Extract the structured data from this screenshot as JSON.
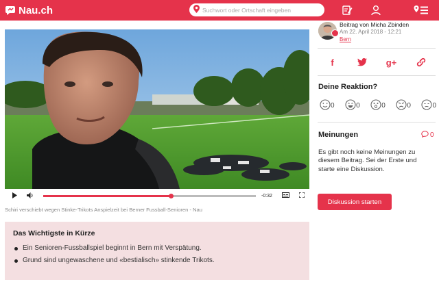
{
  "header": {
    "logo_text": "Nau.ch",
    "search_placeholder": "Suchwort oder Ortschaft eingeben",
    "icons": [
      "pin-icon",
      "edit-icon",
      "user-icon",
      "menu-icon"
    ],
    "brand_color": "#e5334b"
  },
  "video": {
    "time_remaining": "-0:32",
    "progress_fraction": 0.6,
    "caption": "Schiri verschiebt wegen Stinke-Trikots Anspielzeit bei Berner Fussball-Senioren - Nau"
  },
  "summary": {
    "title": "Das Wichtigste in Kürze",
    "bullets": [
      "Ein Senioren-Fussballspiel beginnt in Bern mit Verspätung.",
      "Grund sind ungewaschene und «bestialisch» stinkende Trikots."
    ]
  },
  "author": {
    "byline": "Beitrag von Micha Zbinden",
    "date": "Am 22. April 2018 - 12:21",
    "location": "Bern"
  },
  "share": {
    "icons": [
      "facebook-icon",
      "twitter-icon",
      "google-plus-icon",
      "link-icon"
    ],
    "labels": [
      "f",
      "",
      "g+",
      ""
    ]
  },
  "reactions": {
    "title": "Deine Reaktion?",
    "items": [
      {
        "name": "love",
        "count": "0"
      },
      {
        "name": "laugh",
        "count": "0"
      },
      {
        "name": "surprised",
        "count": "0"
      },
      {
        "name": "angry",
        "count": "0"
      },
      {
        "name": "sad",
        "count": "0"
      }
    ]
  },
  "opinions": {
    "title": "Meinungen",
    "count": "0",
    "text": "Es gibt noch keine Meinungen zu diesem Beitrag. Sei der Erste und starte eine Diskussion.",
    "button_label": "Diskussion starten"
  }
}
